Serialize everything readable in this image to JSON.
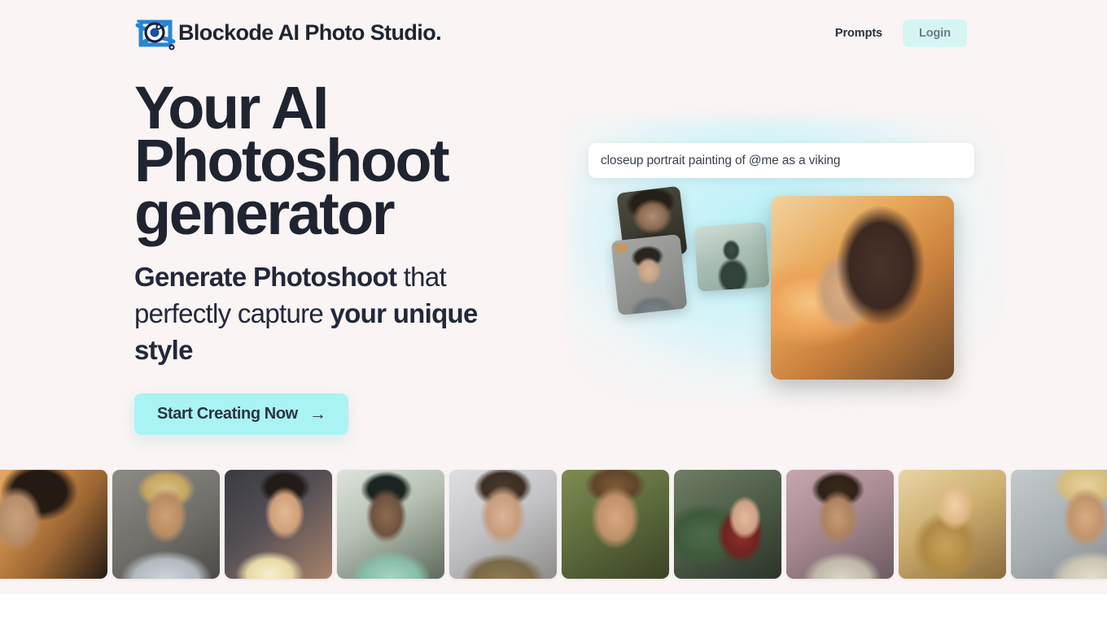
{
  "colors": {
    "page_bg": "#faf4f4",
    "below_bg": "#ffffff",
    "text_dark": "#1f2430",
    "accent_cyan": "#aaf3f4",
    "login_bg": "#d5f5f3",
    "login_text": "#6f7a84",
    "glow": "#b4f0fa",
    "logo_blue": "#1f7fd0"
  },
  "navbar": {
    "logo_icon": "camera-aperture-icon",
    "brand": "Blockode AI Photo Studio.",
    "links": [
      {
        "label": "Prompts",
        "name": "nav-link-prompts"
      }
    ],
    "login_label": "Login"
  },
  "hero": {
    "headline_lines": [
      "Your AI",
      "Photoshoot",
      "generator"
    ],
    "subhead": {
      "part1_bold": "Generate Photoshoot",
      "part2_regular": " that perfectly capture ",
      "part3_bold": "your unique style"
    },
    "cta_label": "Start Creating Now",
    "cta_arrow": "→"
  },
  "prompt": {
    "value": "closeup portrait painting of @me as a viking",
    "placeholder": "closeup portrait painting of @me as a viking"
  },
  "collage": {
    "cards": [
      {
        "name": "collage-thumb-dark-portrait"
      },
      {
        "name": "collage-thumb-teal-backview"
      },
      {
        "name": "collage-thumb-gray-portrait"
      }
    ],
    "hero_image_name": "hero-portrait-viking-woman"
  },
  "gallery": {
    "items": [
      {
        "name": "gallery-item-1",
        "class": "g1",
        "crop": "clip-left"
      },
      {
        "name": "gallery-item-2",
        "class": "g2",
        "crop": "normal"
      },
      {
        "name": "gallery-item-3",
        "class": "g3",
        "crop": "normal"
      },
      {
        "name": "gallery-item-4",
        "class": "g4",
        "crop": "normal"
      },
      {
        "name": "gallery-item-5",
        "class": "g5",
        "crop": "normal"
      },
      {
        "name": "gallery-item-6",
        "class": "g6",
        "crop": "normal"
      },
      {
        "name": "gallery-item-7",
        "class": "g7",
        "crop": "normal"
      },
      {
        "name": "gallery-item-8",
        "class": "g8",
        "crop": "normal"
      },
      {
        "name": "gallery-item-9",
        "class": "g9",
        "crop": "normal"
      },
      {
        "name": "gallery-item-10",
        "class": "g10",
        "crop": "clip-right"
      }
    ]
  }
}
